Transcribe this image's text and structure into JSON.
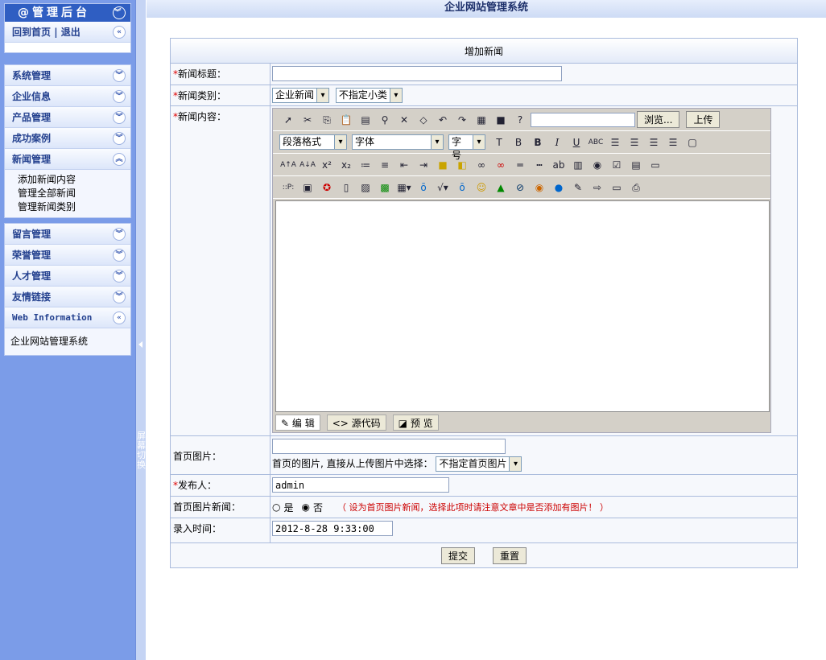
{
  "sidebar": {
    "title": "@管理后台",
    "top_links": [
      "回到首页",
      "退出"
    ],
    "sections": [
      {
        "label": "系统管理"
      },
      {
        "label": "企业信息"
      },
      {
        "label": "产品管理"
      },
      {
        "label": "成功案例"
      },
      {
        "label": "新闻管理",
        "items": [
          "添加新闻内容",
          "管理全部新闻",
          "管理新闻类别"
        ]
      }
    ],
    "sections2": [
      {
        "label": "留言管理"
      },
      {
        "label": "荣誉管理"
      },
      {
        "label": "人才管理"
      },
      {
        "label": "友情链接"
      },
      {
        "label": "Web Information",
        "items": [
          "企业网站管理系统"
        ]
      }
    ],
    "splitter_text": "屏幕切换"
  },
  "topbar": {
    "title": "企业网站管理系统"
  },
  "form": {
    "heading": "增加新闻",
    "title_label": "新闻标题：",
    "category_label": "新闻类别：",
    "category_value": "企业新闻",
    "subcategory_value": "不指定小类",
    "content_label": "新闻内容：",
    "editor": {
      "browse_label": "浏览...",
      "upload_label": "上传",
      "format_select": "段落格式",
      "font_select": "字体",
      "size_select": "字号",
      "modes": [
        "编 辑",
        "源代码",
        "预 览"
      ]
    },
    "image_label": "首页图片：",
    "image_hint": "首页的图片, 直接从上传图片中选择：",
    "image_select": "不指定首页图片",
    "author_label": "发布人：",
    "author_value": "admin",
    "featured_label": "首页图片新闻：",
    "yes": "是",
    "no": "否",
    "featured_note": "（ 设为首页图片新闻，选择此项时请注意文章中是否添加有图片！ ）",
    "time_label": "录入时间：",
    "time_value": "2012-8-28 9:33:00",
    "submit": "提交",
    "reset": "重置"
  }
}
